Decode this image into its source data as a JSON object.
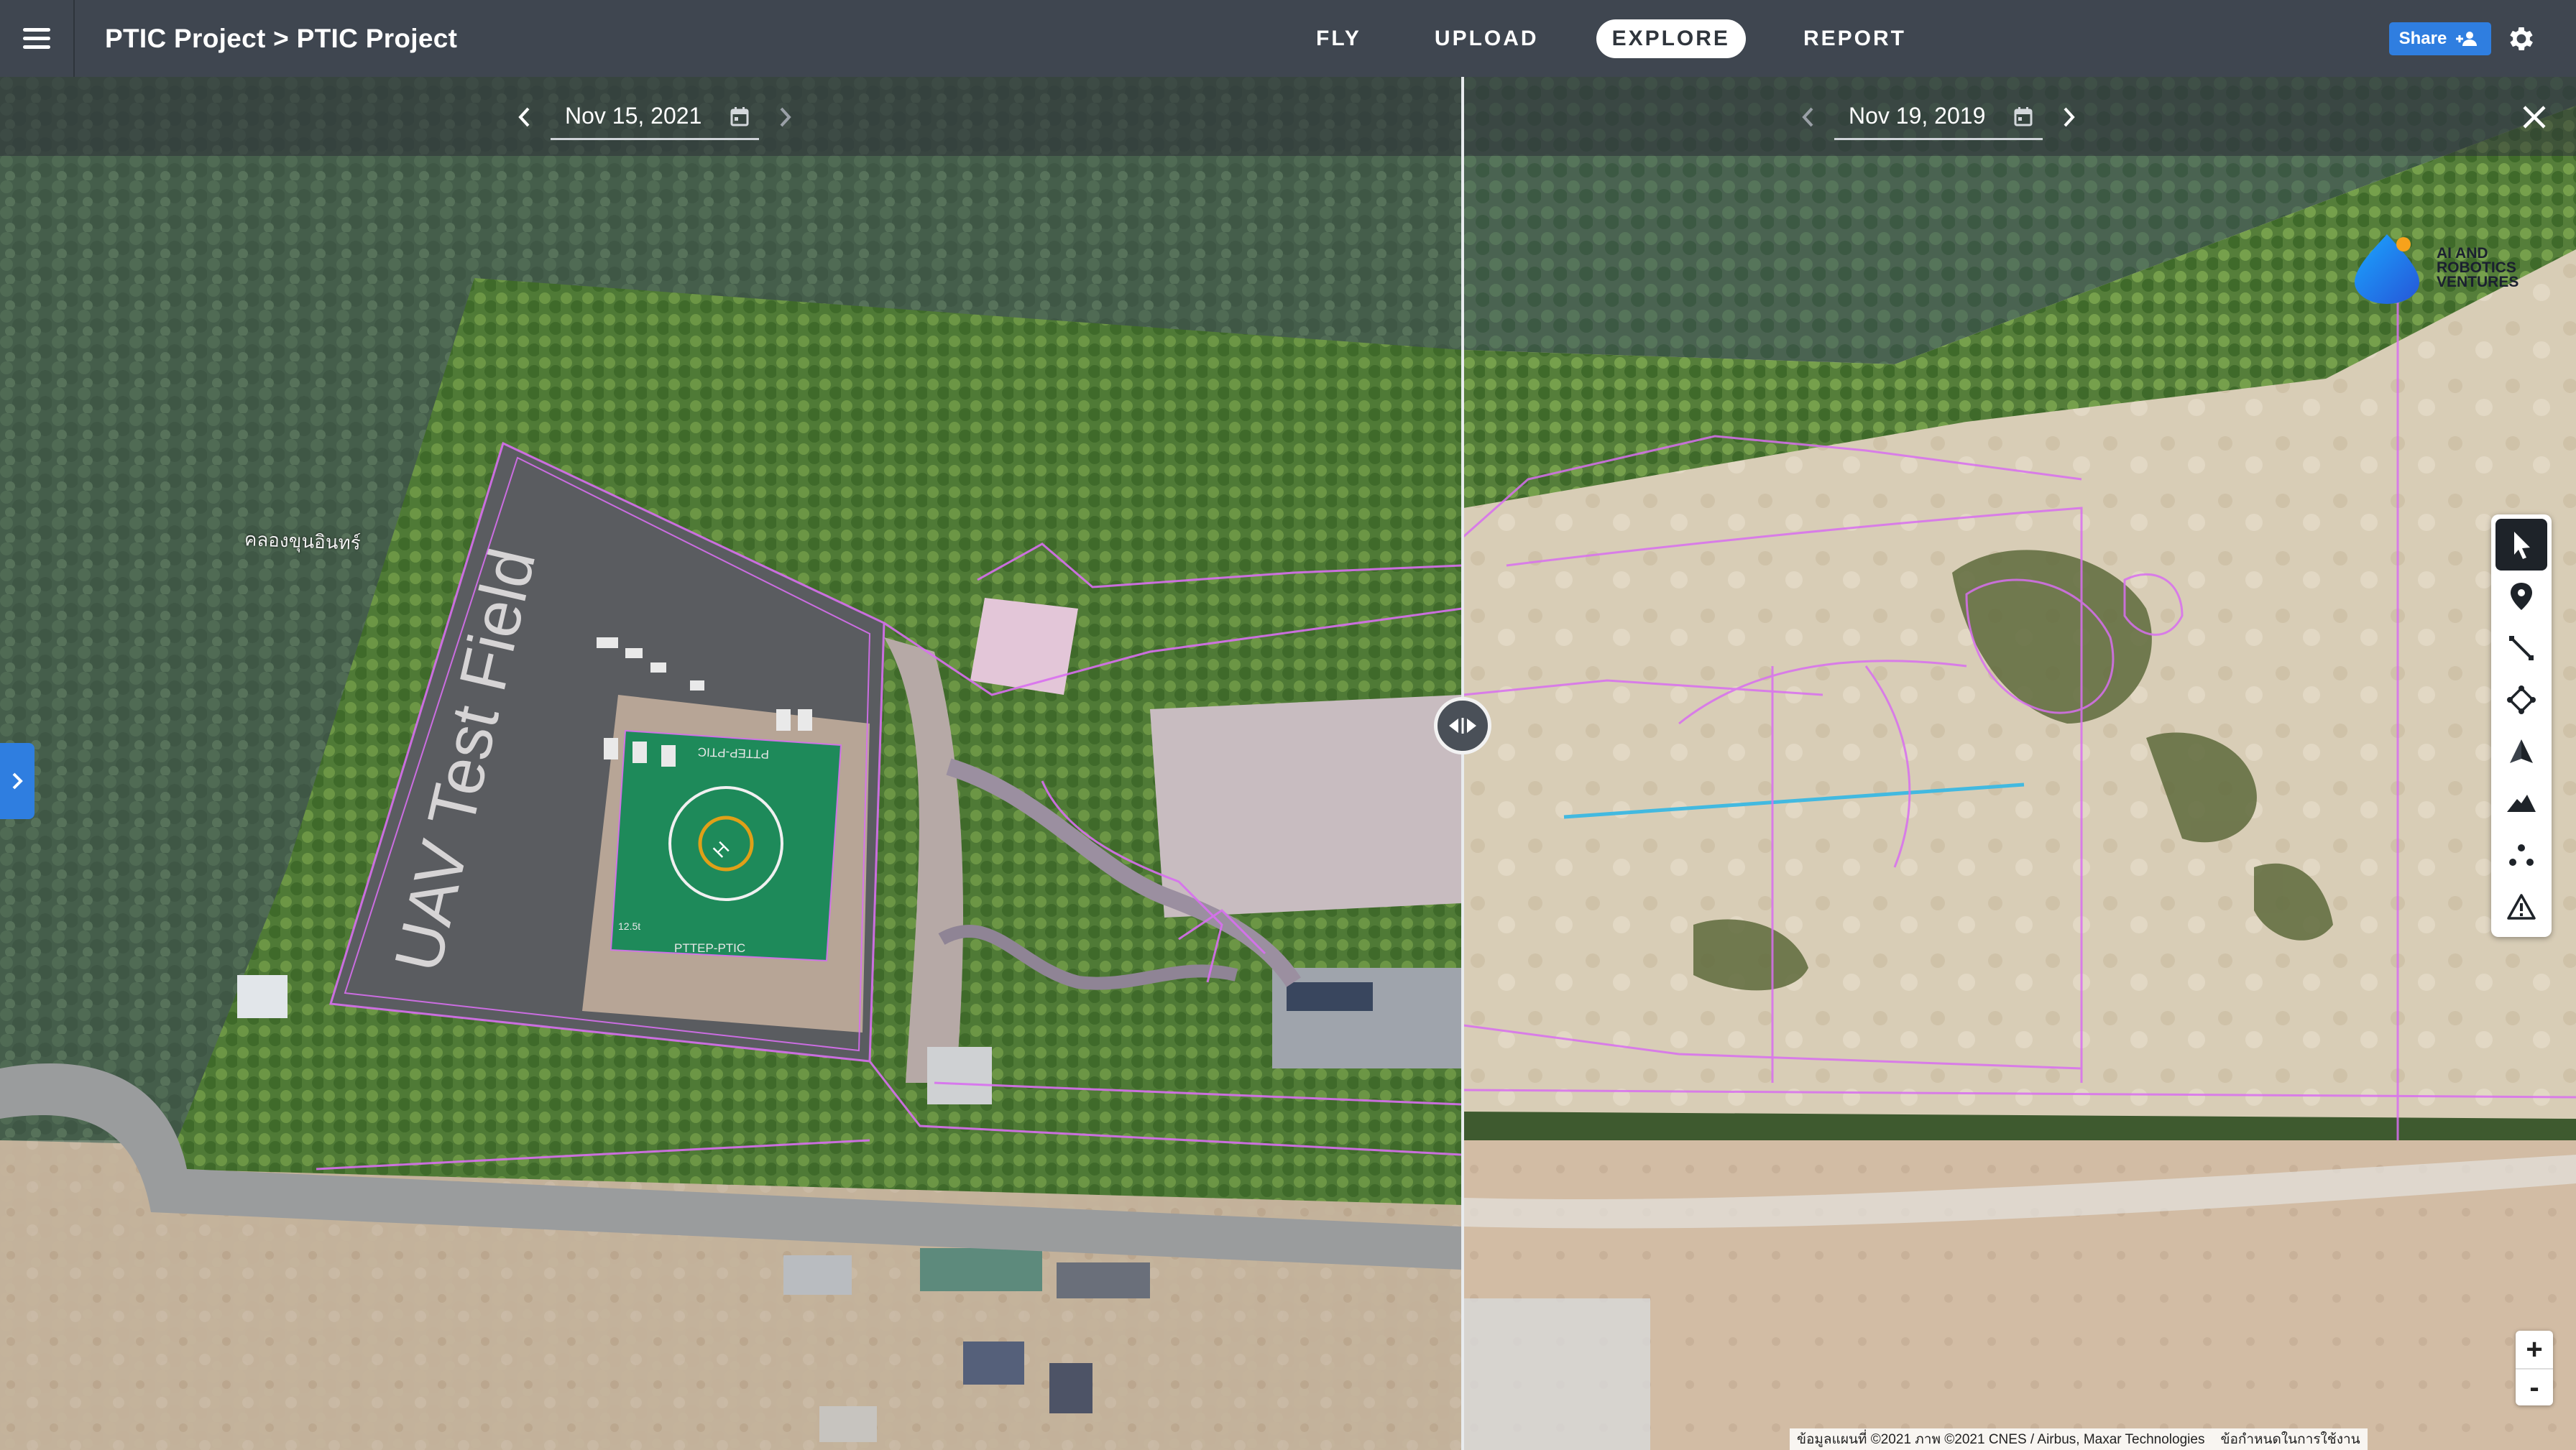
{
  "header": {
    "project_title": "PTIC Project > PTIC Project",
    "nav": [
      {
        "label": "FLY",
        "active": false
      },
      {
        "label": "UPLOAD",
        "active": false
      },
      {
        "label": "EXPLORE",
        "active": true
      },
      {
        "label": "REPORT",
        "active": false
      }
    ],
    "share_label": "Share"
  },
  "compare": {
    "left_date": "Nov 15, 2021",
    "right_date": "Nov 19, 2019"
  },
  "map": {
    "left_overlay_text": "UAV Test Field",
    "helipad_top_text": "PTTEP-PTIC",
    "helipad_bottom_text": "PTTEP-PTIC",
    "helipad_weight_text": "12.5t",
    "place_label": "คลองขุนอินทร์",
    "attribution_left": "ข้อมูลแผนที่ ©2021 ภาพ ©2021 CNES / Airbus, Maxar Technologies",
    "attribution_right": "ข้อกำหนดในการใช้งาน"
  },
  "logo": {
    "line1": "AI AND",
    "line2": "ROBOTICS",
    "line3": "VENTURES"
  },
  "tools": [
    {
      "icon": "pointer-icon",
      "active": true
    },
    {
      "icon": "map-pin-icon",
      "active": false
    },
    {
      "icon": "distance-line-icon",
      "active": false
    },
    {
      "icon": "area-polygon-icon",
      "active": false
    },
    {
      "icon": "volume-icon",
      "active": false
    },
    {
      "icon": "elevation-profile-icon",
      "active": false
    },
    {
      "icon": "point-cloud-icon",
      "active": false
    },
    {
      "icon": "warning-icon",
      "active": false
    }
  ],
  "zoom": {
    "in_label": "+",
    "out_label": "-"
  },
  "colors": {
    "topbar": "#3f4650",
    "accent": "#2f7ee0",
    "annotation_magenta": "#d86ff0",
    "measure_line": "#42b9e0",
    "helipad_green": "#1e8a5a",
    "helipad_ring": "#e0a018"
  }
}
